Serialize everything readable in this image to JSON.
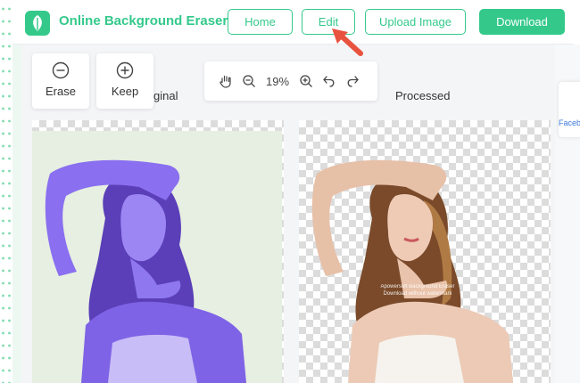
{
  "header": {
    "title": "Online Background Eraser",
    "nav": {
      "home": "Home",
      "edit": "Edit",
      "upload": "Upload Image",
      "download": "Download"
    }
  },
  "tools": {
    "erase": "Erase",
    "keep": "Keep"
  },
  "zoom": {
    "level": "19%"
  },
  "panels": {
    "original_label": "Original",
    "original_visible": "ginal",
    "processed_label": "Processed",
    "watermark": "Apowersoft Background Eraser Download without watermark"
  },
  "side": {
    "share_label": "Faceb"
  },
  "colors": {
    "accent": "#34c98b",
    "arrow": "#e8533f",
    "subject_tint_original": "#7f63e6"
  },
  "icons": [
    "leaf-logo-icon",
    "minus-circle-icon",
    "plus-circle-icon",
    "hand-icon",
    "zoom-out-icon",
    "zoom-in-icon",
    "undo-icon",
    "redo-icon",
    "pointer-arrow-icon"
  ]
}
